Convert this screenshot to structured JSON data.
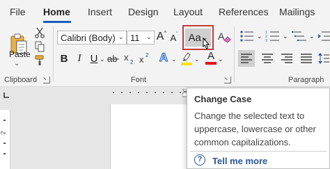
{
  "tabs": [
    {
      "label": "File"
    },
    {
      "label": "Home"
    },
    {
      "label": "Insert"
    },
    {
      "label": "Design"
    },
    {
      "label": "Layout"
    },
    {
      "label": "References"
    },
    {
      "label": "Mailings"
    }
  ],
  "clipboard": {
    "group_label": "Clipboard",
    "paste_label": "Paste"
  },
  "font": {
    "group_label": "Font",
    "family": "Calibri (Body)",
    "size": "11",
    "grow_label": "A",
    "shrink_label": "A",
    "change_case_label": "Aa",
    "bold": "B",
    "italic": "I",
    "underline": "U",
    "text_effects": "A",
    "font_color": "A",
    "highlight_color": "#f7e400",
    "font_color_value": "#e81123"
  },
  "paragraph": {
    "group_label": "Paragraph"
  },
  "ruler": {
    "vertical_mark": "2"
  },
  "tooltip": {
    "title": "Change Case",
    "description": "Change the selected text to uppercase, lowercase or other common capitalizations.",
    "more_link": "Tell me more",
    "help_glyph": "?"
  },
  "colors": {
    "accent": "#185abd",
    "highlight_box": "#c43b3b",
    "link": "#2b579a"
  }
}
